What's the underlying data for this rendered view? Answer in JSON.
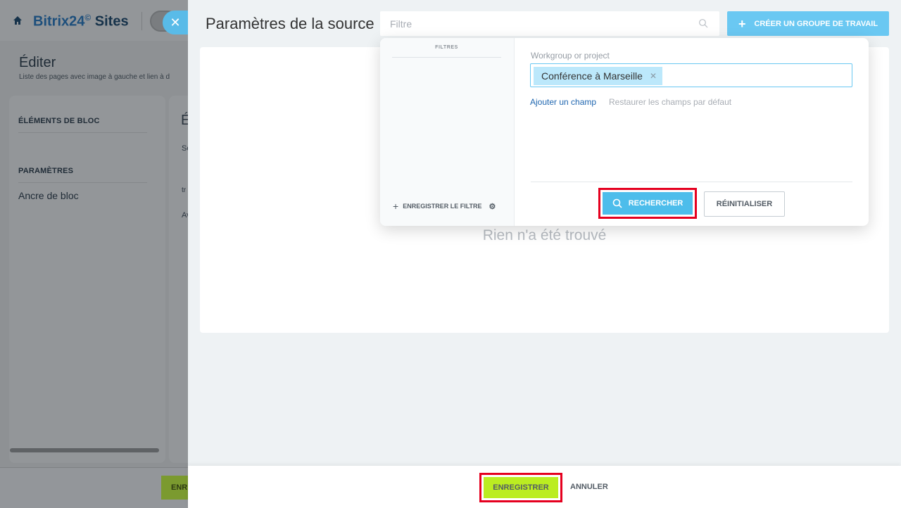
{
  "background": {
    "logo": {
      "part1": "Bitrix24",
      "clock": "©",
      "part2": " Sites"
    },
    "page_title": "Éditer",
    "page_subtitle": "Liste des pages avec image à gauche et lien à d",
    "section_block_elements": "ÉLÉMENTS DE BLOC",
    "section_parameters": "PARAMÈTRES",
    "block_anchor": "Ancre de bloc",
    "partial_letters": [
      "É",
      "Se",
      "tr",
      "Av"
    ],
    "partial_button": "ENR"
  },
  "slider": {
    "title": "Paramètres de la source",
    "search": {
      "placeholder": "Filtre"
    },
    "create_button": "CRÉER UN GROUPE DE TRAVAIL",
    "empty_message": "Rien n'a été trouvé"
  },
  "filter": {
    "sidebar_title": "FILTRES",
    "save_filter": "ENREGISTRER LE FILTRE",
    "field_label": "Workgroup or project",
    "tag_value": "Conférence à Marseille",
    "add_field": "Ajouter un champ",
    "restore_fields": "Restaurer les champs par défaut",
    "search_button": "RECHERCHER",
    "reset_button": "RÉINITIALISER"
  },
  "footer": {
    "save_button": "ENREGISTRER",
    "cancel_button": "ANNULER"
  },
  "colors": {
    "accent_blue": "#6ac8f2",
    "search_blue": "#4dbdeb",
    "save_green": "#bbed21",
    "highlight_red": "#e5001f",
    "link_blue": "#2067b0"
  }
}
